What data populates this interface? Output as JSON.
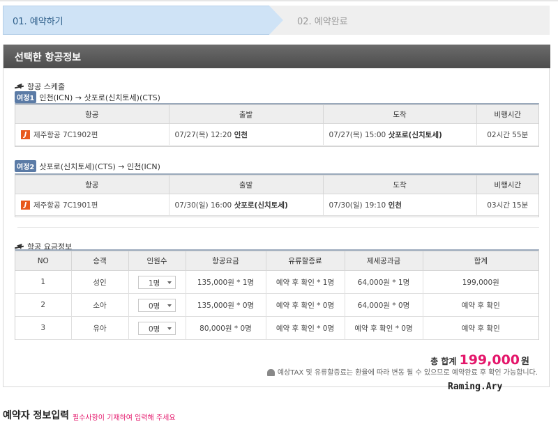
{
  "steps": [
    {
      "label": "01. 예약하기",
      "active": true
    },
    {
      "label": "02. 예약완료",
      "active": false
    }
  ],
  "panel": {
    "title": "선택한 항공정보"
  },
  "schedule": {
    "title": "항공 스케줄",
    "columns": [
      "항공",
      "출발",
      "도착",
      "비행시간"
    ],
    "legs": [
      {
        "tag": "여정1",
        "route": "인천(ICN) → 삿포로(신치토세)(CTS)",
        "airline": "제주항공 7C1902편",
        "dep_time": "07/27(목) 12:20",
        "dep_city": "인천",
        "arr_time": "07/27(목) 15:00",
        "arr_city": "삿포로(신치토세)",
        "duration": "02시간 55분"
      },
      {
        "tag": "여정2",
        "route": "삿포로(신치토세)(CTS) → 인천(ICN)",
        "airline": "제주항공 7C1901편",
        "dep_time": "07/30(일) 16:00",
        "dep_city": "삿포로(신치토세)",
        "arr_time": "07/30(일) 19:10",
        "arr_city": "인천",
        "duration": "03시간 15분"
      }
    ]
  },
  "fare": {
    "title": "항공 요금정보",
    "columns": [
      "NO",
      "승객",
      "인원수",
      "항공요금",
      "유류할증료",
      "제세공과금",
      "합계"
    ],
    "rows": [
      {
        "no": "1",
        "type": "성인",
        "count": "1명",
        "fare": "135,000원 * 1명",
        "fuel": "예약 후 확인 * 1명",
        "tax": "64,000원 * 1명",
        "total": "199,000원"
      },
      {
        "no": "2",
        "type": "소아",
        "count": "0명",
        "fare": "135,000원 * 0명",
        "fuel": "예약 후 확인 * 0명",
        "tax": "64,000원 * 0명",
        "total": "예약 후 확인"
      },
      {
        "no": "3",
        "type": "유아",
        "count": "0명",
        "fare": "80,000원 * 0명",
        "fuel": "예약 후 확인 * 0명",
        "tax": "예약 후 확인 * 0명",
        "total": "예약 후 확인"
      }
    ]
  },
  "total": {
    "label": "총 합계",
    "amount": "199,000",
    "unit": "원"
  },
  "notice": "예상TAX 및 유류할증료는 환율에 따라 변동 될 수 있으므로 예약완료 후 확인 가능합니다.",
  "watermark": "Raming.Ary",
  "next_section": {
    "title": "예약자 정보입력",
    "subtitle": "필수사항이 기재하여 입력해 주세요"
  },
  "colors": {
    "accent_pink": "#e4176b",
    "jeju_orange": "#e8581c",
    "tag_blue": "#5b7ba6"
  }
}
